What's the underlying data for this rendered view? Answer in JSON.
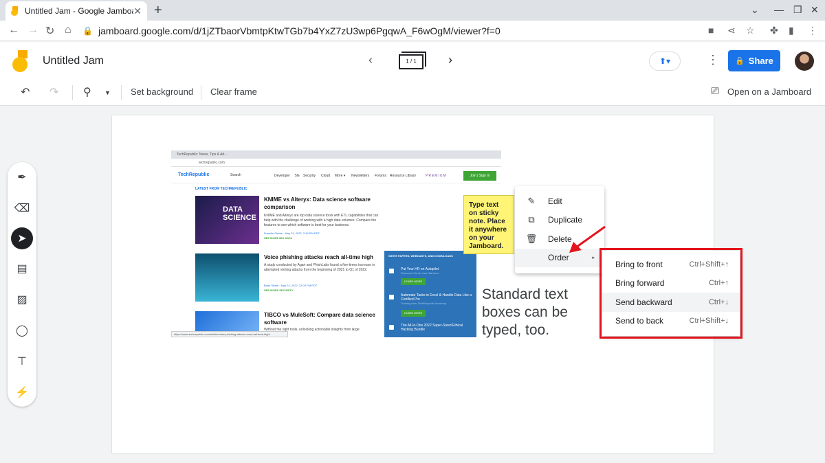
{
  "browser": {
    "tab_title": "Untitled Jam - Google Jamboard",
    "tab_close": "✕",
    "new_tab": "+",
    "url": "jamboard.google.com/d/1jZTbaorVbmtpKtwTGb7b4YxZ7zU3wp6PgqwA_F6wOgM/viewer?f=0"
  },
  "app": {
    "title": "Untitled Jam",
    "frame_indicator": "1 / 1",
    "share_label": "Share"
  },
  "toolbar": {
    "set_background": "Set background",
    "clear_frame": "Clear frame",
    "open_on_jamboard": "Open on a Jamboard"
  },
  "embedded_screenshot": {
    "tab": "TechRepublic: News, Tips & Ad...",
    "url": "techrepublic.com",
    "logo": "TechRepublic",
    "search": "Search",
    "nav": [
      "Developer",
      "5G",
      "Security",
      "Cloud",
      "More ▾",
      "Newsletters",
      "Forums",
      "Resource Library"
    ],
    "premium": "PREMIUM",
    "join": "Join | Sign In",
    "latest": "LATEST FROM TECHREPUBLIC",
    "articles": [
      {
        "headline": "KNIME vs Alteryx: Data science software comparison",
        "body": "KNIME and Alteryx are top data science tools with ETL capabilities that can help with the challenge of working with a high data volumes. Compare the features to see which software is best for your business.",
        "byline": "Franklin Okeke · May 24, 2022, 2:34 PM PDT",
        "more": "SEE MORE BIG DATA",
        "thumb_text": "DATA SCIENCE"
      },
      {
        "headline": "Voice phishing attacks reach all-time high",
        "body": "A study conducted by Agari and PhishLabs found a five-times increase in attempted vishing attacks from the beginning of 2021 to Q1 of 2022.",
        "byline": "Brian Stone · May 24, 2022, 12:03 PM PDT",
        "more": "SEE MORE SECURITY"
      },
      {
        "headline": "TIBCO vs MuleSoft: Compare data science software",
        "body": "Without the right tools, unlocking actionable insights from large"
      }
    ],
    "papers_header": "WHITE PAPERS, WEBCASTS, AND DOWNLOADS",
    "papers": [
      {
        "title": "Put Your HR on Autopilot",
        "sub": "Resource Center from Bamboo",
        "btn": "LEARN MORE"
      },
      {
        "title": "Automate Tasks in Excel & Handle Data Like a Certified Pro",
        "sub": "Training from TechRepublic Academy",
        "btn": "LEARN MORE"
      },
      {
        "title": "The All-In-One 2022 Super-Sized Ethical Hacking Bundle",
        "sub": "",
        "btn": ""
      }
    ],
    "status_url": "https://www.techrepublic.com/article/voice-phishing-attacks-reach-all-time-high/"
  },
  "sticky_note": "Type text on sticky note. Place it anywhere on your Jamboard.",
  "text_box": "Standard text boxes can be typed, too.",
  "context_menu": {
    "items": [
      {
        "label": "Edit",
        "icon": "✎"
      },
      {
        "label": "Duplicate",
        "icon": "⧉"
      },
      {
        "label": "Delete",
        "icon": "🗑"
      },
      {
        "label": "Order",
        "icon": ""
      }
    ],
    "submenu_arrow": "▸"
  },
  "submenu": {
    "items": [
      {
        "label": "Bring to front",
        "shortcut": "Ctrl+Shift+↑"
      },
      {
        "label": "Bring forward",
        "shortcut": "Ctrl+↑"
      },
      {
        "label": "Send backward",
        "shortcut": "Ctrl+↓"
      },
      {
        "label": "Send to back",
        "shortcut": "Ctrl+Shift+↓"
      }
    ]
  },
  "colors": {
    "accent": "#1a73e8",
    "sticky": "#fff475",
    "highlight_box": "#e3141e"
  }
}
